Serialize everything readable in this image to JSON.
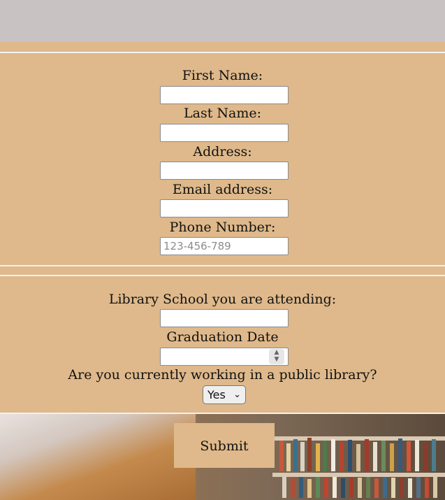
{
  "personal": {
    "first_name_label": "First Name:",
    "last_name_label": "Last Name:",
    "address_label": "Address:",
    "email_label": "Email address:",
    "phone_label": "Phone Number:",
    "phone_placeholder": "123-456-789"
  },
  "school": {
    "library_school_label": "Library School you are attending:",
    "graduation_label": "Graduation Date",
    "working_label": "Are you currently working in a public library?",
    "working_selected": "Yes"
  },
  "submit_label": "Submit",
  "colors": {
    "form_bg": "#dfb98b",
    "top_band": "#c9c2c2"
  }
}
